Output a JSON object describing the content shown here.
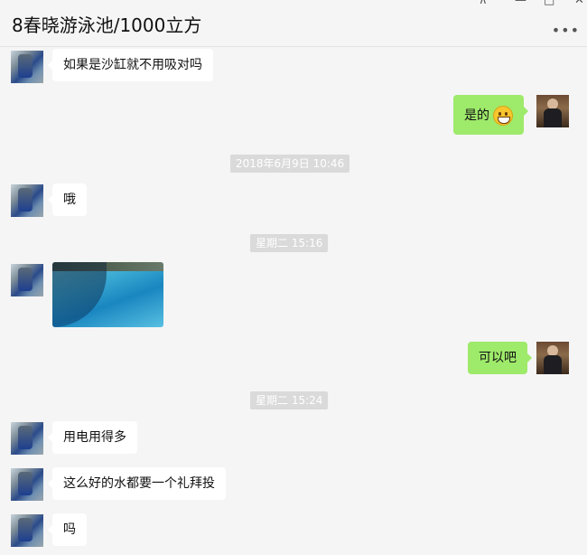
{
  "window": {
    "title": "8春晓游泳池/1000立方",
    "pin_icon": "pin-icon",
    "minimize_icon": "minimize-icon",
    "maximize_icon": "maximize-icon",
    "close_icon": "close-icon",
    "more_icon": "more-icon"
  },
  "messages": [
    {
      "side": "in",
      "text": "如果是沙缸就不用吸对吗"
    },
    {
      "side": "out",
      "text": "是的",
      "emoji": "grinning-face-emoji"
    },
    {
      "type": "timestamp",
      "text": "2018年6月9日 10:46"
    },
    {
      "side": "in",
      "text": "哦"
    },
    {
      "type": "timestamp",
      "text": "星期二 15:16"
    },
    {
      "side": "in",
      "type": "image",
      "image": "swimming-pool-photo"
    },
    {
      "side": "out",
      "text": "可以吧"
    },
    {
      "type": "timestamp",
      "text": "星期二 15:24"
    },
    {
      "side": "in",
      "text": "用电用得多"
    },
    {
      "side": "in",
      "text": "这么好的水都要一个礼拜投"
    },
    {
      "side": "in",
      "text": "吗"
    }
  ],
  "colors": {
    "background": "#f5f5f5",
    "bubble_in": "#ffffff",
    "bubble_out": "#9eea6a",
    "timestamp_bg": "#dadada"
  }
}
